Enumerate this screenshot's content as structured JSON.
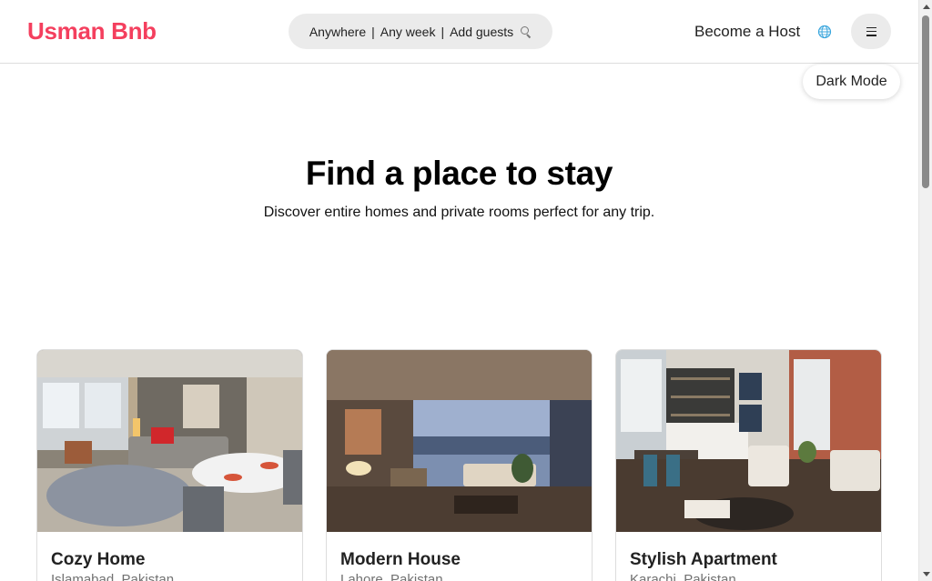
{
  "header": {
    "logo": "Usman Bnb",
    "search": {
      "anywhere": "Anywhere",
      "separator": "|",
      "week": "Any week",
      "guests": "Add guests"
    },
    "host_label": "Become a Host"
  },
  "tooltip": "Dark Mode",
  "hero": {
    "title": "Find a place to stay",
    "subtitle": "Discover entire homes and private rooms perfect for any trip."
  },
  "cards": [
    {
      "title": "Cozy Home",
      "location": "Islamabad, Pakistan"
    },
    {
      "title": "Modern House",
      "location": "Lahore, Pakistan"
    },
    {
      "title": "Stylish Apartment",
      "location": "Karachi, Pakistan"
    }
  ],
  "colors": {
    "brand": "#f43f5e",
    "search_bg": "#ebebeb",
    "globe": "#3aa6dd"
  },
  "icons": {
    "search": "search-icon",
    "globe": "globe-icon",
    "menu": "menu-icon"
  }
}
